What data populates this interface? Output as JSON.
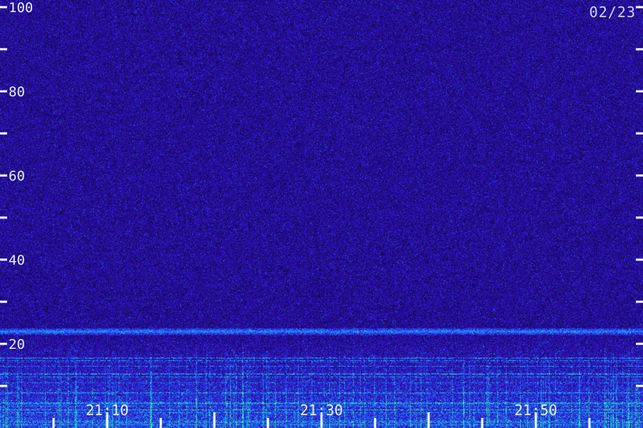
{
  "chart_data": {
    "type": "heatmap",
    "title": "",
    "date": "02/23",
    "xlabel": "",
    "ylabel": "",
    "y_ticks": [
      20,
      40,
      60,
      80,
      100
    ],
    "y_tick_labels": [
      "20",
      "40",
      "60",
      "80",
      "100"
    ],
    "y_minor_ticks": [
      10,
      30,
      50,
      70,
      90
    ],
    "ylim": [
      0,
      101.7
    ],
    "x_tick_labels": [
      "21:10",
      "21:30",
      "21:50"
    ],
    "x_start": "21:00",
    "x_end": "22:00",
    "x_major_ticks": [
      "21:10",
      "21:20",
      "21:30",
      "21:40",
      "21:50"
    ],
    "x_minor_tick_minutes": 5,
    "colormap": [
      "#000000",
      "#1a0a6e",
      "#3411c8",
      "#1f6cff",
      "#10c9e6",
      "#38ff8a"
    ],
    "features": {
      "background": "diffuse noise, low intensity",
      "band_near_y": 23,
      "band_strength": "moderate",
      "low_frequency_activity": "strong below ~17"
    }
  }
}
